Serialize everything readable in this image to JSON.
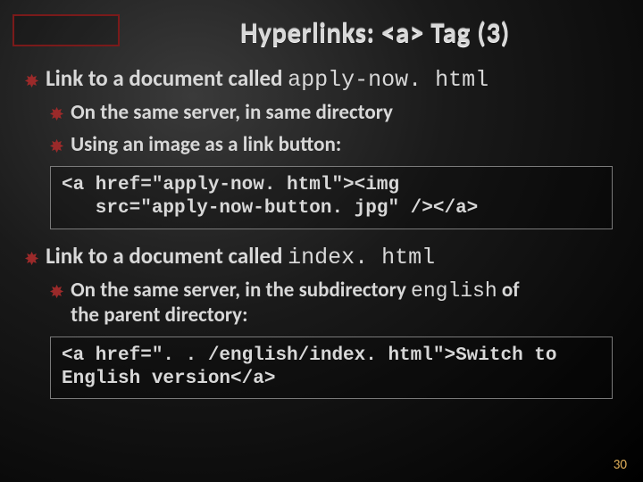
{
  "title": "Hyperlinks: <a> Tag (3)",
  "section1": {
    "headPlain": "Link to a document called ",
    "headCode": "apply-now. html",
    "sub1": "On the same server, in same directory",
    "sub2": "Using an image as a link button:",
    "code": "<a href=\"apply-now. html\"><img\n   src=\"apply-now-button. jpg\" /></a>"
  },
  "section2": {
    "headPlain": "Link to a document called ",
    "headCode": "index. html",
    "sub1a": "On the same server, in the subdirectory ",
    "sub1code": "english",
    "sub1b": " of",
    "sub1c": "the parent directory:",
    "code": "<a href=\". . /english/index. html\">Switch to\nEnglish version</a>"
  },
  "pageNumber": "30"
}
